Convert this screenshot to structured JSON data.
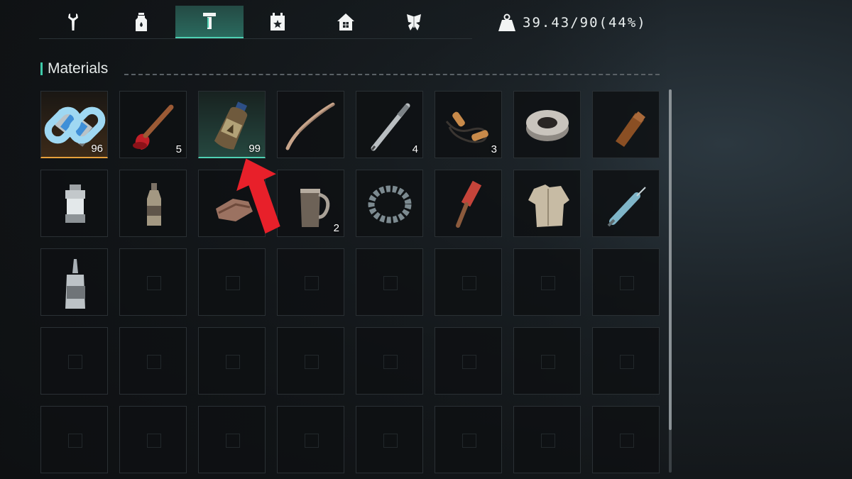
{
  "tabs": [
    {
      "icon": "wrench-icon",
      "active": false
    },
    {
      "icon": "bottle-icon",
      "active": false
    },
    {
      "icon": "materials-icon",
      "active": true
    },
    {
      "icon": "calendar-star-icon",
      "active": false
    },
    {
      "icon": "house-icon",
      "active": false
    },
    {
      "icon": "butterfly-icon",
      "active": false
    }
  ],
  "weight": {
    "text": "39.43/90(44%)",
    "icon": "weight-icon"
  },
  "section": {
    "title": "Materials"
  },
  "slots": [
    {
      "item": "battery",
      "qty": "96",
      "highlight": "orange",
      "linked": true
    },
    {
      "item": "plunger",
      "qty": "5"
    },
    {
      "item": "chemical-bottle",
      "qty": "99",
      "highlight": "green"
    },
    {
      "item": "clothes-hanger",
      "qty": ""
    },
    {
      "item": "pen",
      "qty": "4"
    },
    {
      "item": "jump-rope",
      "qty": "3"
    },
    {
      "item": "tape-roll",
      "qty": ""
    },
    {
      "item": "wood-piece",
      "qty": ""
    },
    {
      "item": "lantern",
      "qty": ""
    },
    {
      "item": "metal-bottle",
      "qty": ""
    },
    {
      "item": "leather-scraps",
      "qty": ""
    },
    {
      "item": "pitcher",
      "qty": "2"
    },
    {
      "item": "bracelet",
      "qty": ""
    },
    {
      "item": "paint-roller",
      "qty": ""
    },
    {
      "item": "jacket",
      "qty": ""
    },
    {
      "item": "syringe",
      "qty": ""
    },
    {
      "item": "glue-bottle",
      "qty": ""
    }
  ],
  "grid": {
    "columns": 8,
    "rows": 5
  },
  "colors": {
    "accent": "#4fd1b3",
    "highlight_orange": "#e7a03c",
    "arrow": "#e8202a"
  }
}
